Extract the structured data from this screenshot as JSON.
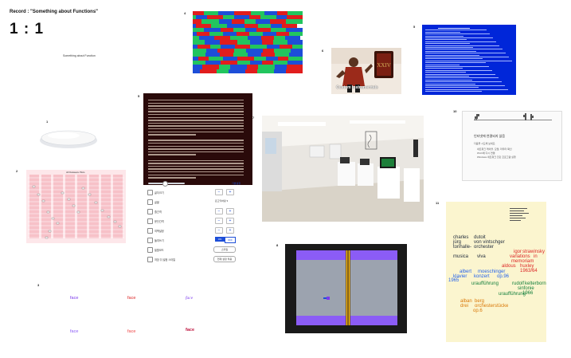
{
  "header": {
    "title": "Record : \"Something about Functions\"",
    "ratio": "1 : 1",
    "subtitle": "Something about Function"
  },
  "labels": {
    "p1": "1",
    "p2": "2",
    "p3": "3",
    "p4": "4",
    "p5": "5",
    "p6": "6",
    "p7": "7",
    "p8": "8",
    "p9": "9",
    "p10": "10",
    "p11": "11"
  },
  "album": {
    "text": "Custom Instrumentals"
  },
  "chart": {
    "title": "All Datasets Plots"
  },
  "settings": {
    "rows": [
      {
        "label": "글자크기",
        "type": "stepper"
      },
      {
        "label": "글꼴",
        "type": "dropdown",
        "value": "은고딕바탕"
      },
      {
        "label": "줄간격",
        "type": "stepper"
      },
      {
        "label": "문단간격",
        "type": "stepper"
      },
      {
        "label": "여백설정",
        "type": "stepper"
      },
      {
        "label": "들여쓰기",
        "type": "toggle",
        "on": "ON",
        "off": "OFF"
      },
      {
        "label": "밑줄모드",
        "type": "pill",
        "value": "스타일"
      },
      {
        "label": "저장 뒤 설정 스타일",
        "type": "pill",
        "value": "현재 설정 적용"
      }
    ],
    "top_value": "기본설정"
  },
  "panel10": {
    "heading": "인터넷에 연결되지 않음",
    "hint": "다음을 시도해 보세요.",
    "items": [
      "네트워크 케이블, 모뎀, 라우터 확인",
      "Wi-Fi에 다시 연결",
      "Windows 네트워크 진단 프로그램 실행"
    ]
  },
  "faces": [
    {
      "text": "face",
      "color": "#7c3aed"
    },
    {
      "text": "face",
      "color": "#dc2626"
    },
    {
      "text": "face",
      "color": "#7c3aed"
    },
    {
      "text": "face",
      "color": "#8b5cf6"
    },
    {
      "text": "face",
      "color": "#ef4444"
    },
    {
      "text": "face",
      "color": "#be123c"
    }
  ],
  "poster": {
    "lines": [
      {
        "text": "charles",
        "color": "#1e293b"
      },
      {
        "text": "jürg",
        "color": "#1e293b"
      },
      {
        "text": "tonhalle-",
        "color": "#1e293b"
      },
      {
        "text": "dutoit",
        "color": "#1e293b"
      },
      {
        "text": "von vintschger",
        "color": "#1e293b"
      },
      {
        "text": "orchester",
        "color": "#1e293b"
      },
      {
        "text": "musica",
        "color": "#1e293b"
      },
      {
        "text": "viva",
        "color": "#1e293b"
      },
      {
        "text": "igor",
        "color": "#dc2626"
      },
      {
        "text": "strawinsky",
        "color": "#dc2626"
      },
      {
        "text": "variations",
        "color": "#dc2626"
      },
      {
        "text": "in",
        "color": "#dc2626"
      },
      {
        "text": "memoriam",
        "color": "#dc2626"
      },
      {
        "text": "aldous",
        "color": "#dc2626"
      },
      {
        "text": "huxley",
        "color": "#dc2626"
      },
      {
        "text": "1963/64",
        "color": "#dc2626"
      },
      {
        "text": "albert",
        "color": "#2563eb"
      },
      {
        "text": "moeschinger",
        "color": "#2563eb"
      },
      {
        "text": "klavier",
        "color": "#2563eb"
      },
      {
        "text": "konzert",
        "color": "#2563eb"
      },
      {
        "text": "op.96",
        "color": "#2563eb"
      },
      {
        "text": "1965",
        "color": "#2563eb"
      },
      {
        "text": "uraufführung",
        "color": "#15803d"
      },
      {
        "text": "rudolf",
        "color": "#15803d"
      },
      {
        "text": "kelterborn",
        "color": "#15803d"
      },
      {
        "text": "sinfonie",
        "color": "#15803d"
      },
      {
        "text": "1966",
        "color": "#15803d"
      },
      {
        "text": "uraufführung",
        "color": "#15803d"
      },
      {
        "text": "alban",
        "color": "#d97706"
      },
      {
        "text": "berg",
        "color": "#d97706"
      },
      {
        "text": "drei",
        "color": "#d97706"
      },
      {
        "text": "orchesterstücke",
        "color": "#d97706"
      },
      {
        "text": "op.6",
        "color": "#d97706"
      }
    ]
  },
  "colors": {
    "stripe_red": "#e11d1d",
    "stripe_green": "#22c55e",
    "stripe_blue": "#1d4ed8",
    "bsod": "#0026d9",
    "poster_bg": "#fbf5cf"
  }
}
